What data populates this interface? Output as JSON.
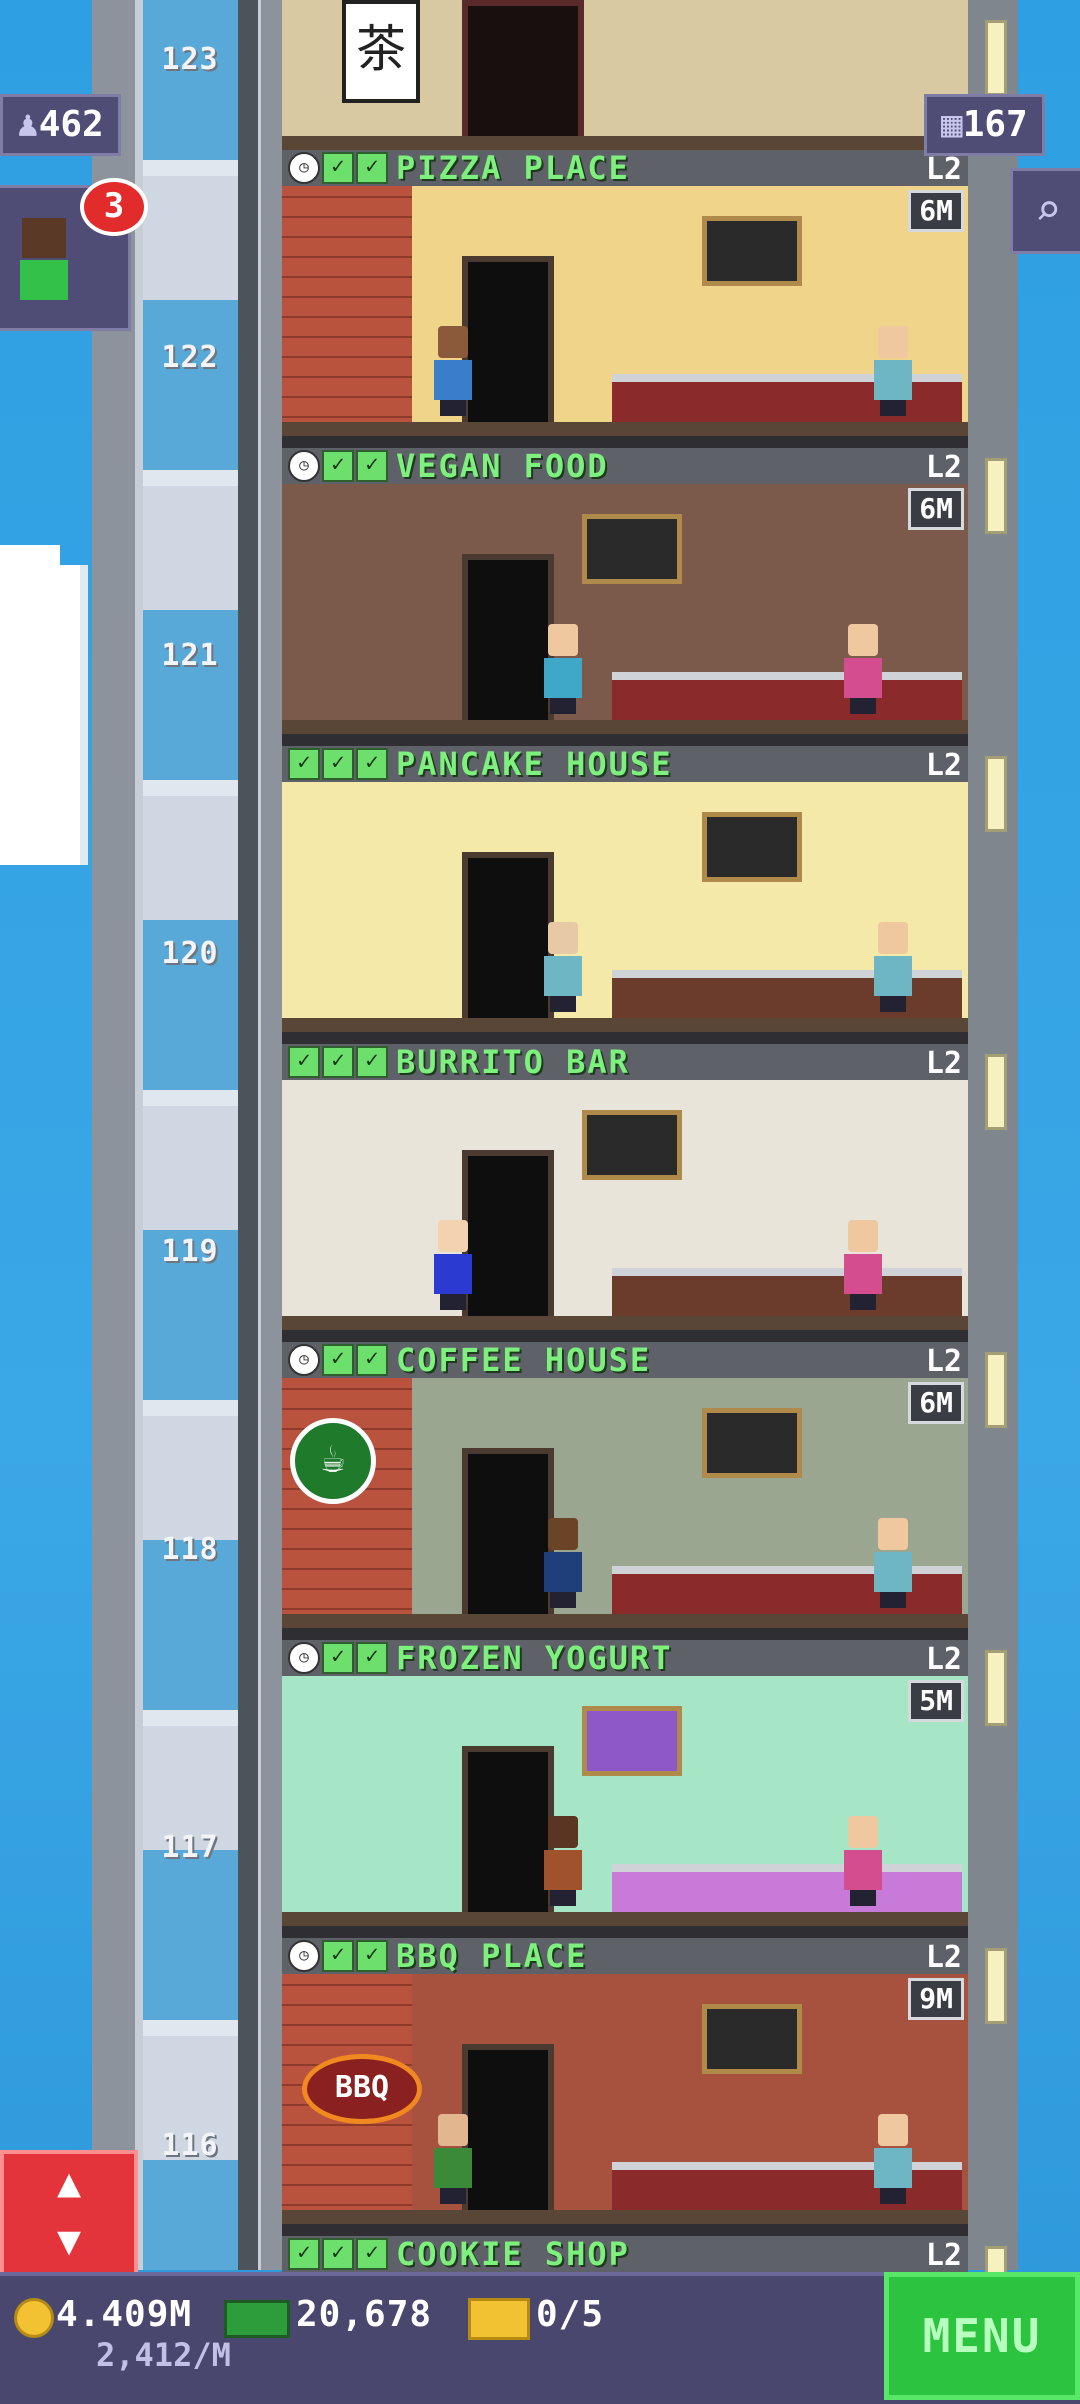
{
  "hud": {
    "population": "462",
    "population_icon": "person-icon",
    "floors_count": "167",
    "floors_icon": "building-icon",
    "notification_count": "3",
    "search_icon": "magnifier-icon",
    "elevator_icon": "up-down-arrows-icon"
  },
  "floor_numbers": [
    "123",
    "122",
    "121",
    "120",
    "119",
    "118",
    "117",
    "116"
  ],
  "floors": [
    {
      "name": "PIZZA PLACE",
      "level": "L2",
      "time": "6M",
      "clock": true,
      "checks": 2,
      "theme": "#f0d489"
    },
    {
      "name": "VEGAN FOOD",
      "level": "L2",
      "time": "6M",
      "clock": true,
      "checks": 2,
      "theme": "#7b5a4b"
    },
    {
      "name": "PANCAKE HOUSE",
      "level": "L2",
      "time": "",
      "clock": false,
      "checks": 3,
      "theme": "#f5e9a9"
    },
    {
      "name": "BURRITO BAR",
      "level": "L2",
      "time": "",
      "clock": false,
      "checks": 3,
      "theme": "#e9e4da"
    },
    {
      "name": "COFFEE HOUSE",
      "level": "L2",
      "time": "6M",
      "clock": true,
      "checks": 2,
      "theme": "#9aa690"
    },
    {
      "name": "FROZEN YOGURT",
      "level": "L2",
      "time": "5M",
      "clock": true,
      "checks": 2,
      "theme": "#a6e6c6"
    },
    {
      "name": "BBQ PLACE",
      "level": "L2",
      "time": "9M",
      "clock": true,
      "checks": 2,
      "theme": "#a6523e"
    },
    {
      "name": "COOKIE SHOP",
      "level": "L2",
      "time": "",
      "clock": false,
      "checks": 3,
      "theme": "#6e6e6e"
    }
  ],
  "signs": {
    "bbq_sign": "BBQ",
    "top_floor_glyph": "茶"
  },
  "bottom": {
    "coins": "4.409M",
    "coins_rate": "2,412/M",
    "bux": "20,678",
    "tickets": "0/5",
    "menu_label": "MENU"
  }
}
